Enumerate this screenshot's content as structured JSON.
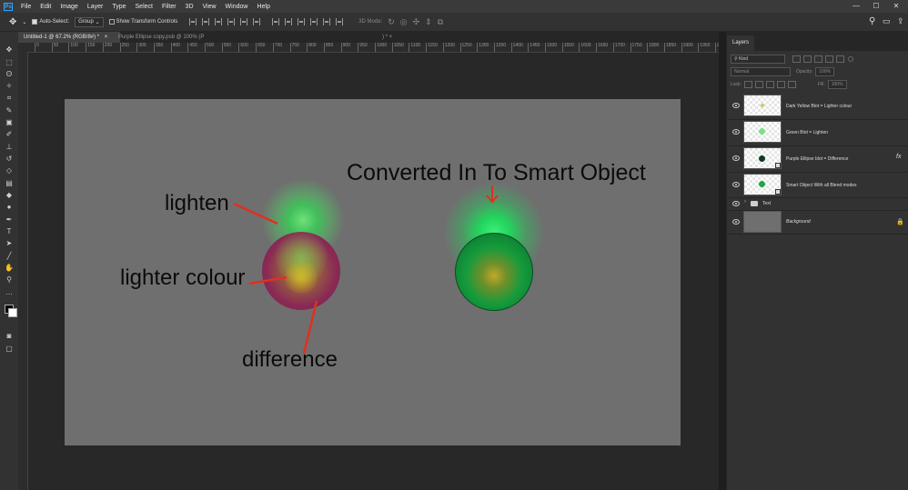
{
  "app": {
    "logo": "Ps"
  },
  "menu": {
    "items": [
      "File",
      "Edit",
      "Image",
      "Layer",
      "Type",
      "Select",
      "Filter",
      "3D",
      "View",
      "Window",
      "Help"
    ]
  },
  "options_bar": {
    "auto_select_label": "Auto-Select:",
    "auto_select_value": "Group",
    "transform_label": "Show Transform Controls",
    "mode_3d_label": "3D Mode:"
  },
  "tabs": [
    {
      "label": "Untitled-1 @ 67.2% (RGB/8#) *",
      "close": "×"
    },
    {
      "label": "Purple Ellipse copy.psb @ 100% (P",
      "close": ") *  ×"
    }
  ],
  "ruler": {
    "ticks": [
      "0",
      "50",
      "100",
      "150",
      "200",
      "250",
      "300",
      "350",
      "400",
      "450",
      "500",
      "550",
      "600",
      "650",
      "700",
      "750",
      "800",
      "850",
      "900",
      "950",
      "1000",
      "1050",
      "1100",
      "1150",
      "1200",
      "1250",
      "1300",
      "1350",
      "1400",
      "1450",
      "1500",
      "1550",
      "1600",
      "1650",
      "1700",
      "1750",
      "1800",
      "1850",
      "1900",
      "1950",
      "2000"
    ]
  },
  "canvas": {
    "annotations": {
      "lighten": "lighten",
      "lighter_colour": "lighter colour",
      "difference": "difference",
      "smart_object": "Converted In To Smart Object"
    },
    "colors": {
      "artboard": "#6f6f6f",
      "arrow": "#e0301e",
      "green_orb": "#0d8a3a",
      "purple_orb": "#8a1e4a"
    }
  },
  "layers_panel": {
    "tab_label": "Layers",
    "filter_kind": "Kind",
    "blend_mode": "Normal",
    "opacity_label": "Opacity:",
    "opacity_value": "100%",
    "lock_label": "Lock:",
    "fill_label": "Fill:",
    "fill_value": "100%",
    "fx_label": "fx",
    "layers": [
      {
        "name": "Dark Yellow Blot  = Lighter colour"
      },
      {
        "name": "Green Blot = Lighten"
      },
      {
        "name": "Purple Ellipse blot =  Difference"
      },
      {
        "name": "Smart Object With all Blend modes"
      },
      {
        "name": "Text"
      },
      {
        "name": "Background"
      }
    ]
  }
}
